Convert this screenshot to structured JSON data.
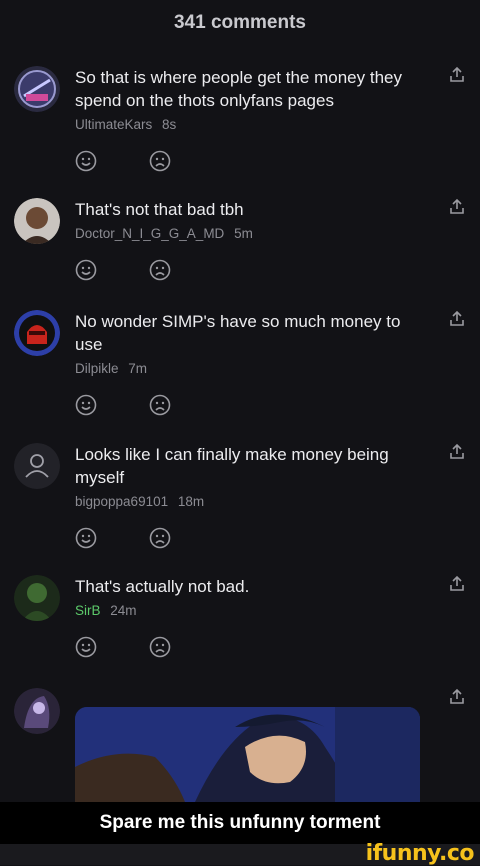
{
  "header": {
    "title": "341 comments"
  },
  "comments": [
    {
      "text": "So that is where people get the money they spend on the thots onlyfans pages",
      "user": "UltimateKars",
      "time": "8s",
      "avatar": "ultimate-kars-logo"
    },
    {
      "text": "That's not that bad tbh",
      "user": "Doctor_N_I_G_G_A_MD",
      "time": "5m",
      "avatar": "profile-photo"
    },
    {
      "text": "No wonder SIMP's have so much money to use",
      "user": "Dilpikle",
      "time": "7m",
      "avatar": "red-helmet"
    },
    {
      "text": "Looks like I can finally make money being myself",
      "user": "bigpoppa69101",
      "time": "18m",
      "avatar": "default-user"
    },
    {
      "text": "That's actually not bad.",
      "user": "SirB",
      "time": "24m",
      "avatar": "green-figure"
    },
    {
      "text": "",
      "user": "",
      "time": "",
      "avatar": "anime-character"
    }
  ],
  "caption": "Spare me this unfunny torment",
  "brand": "ifunny.co"
}
